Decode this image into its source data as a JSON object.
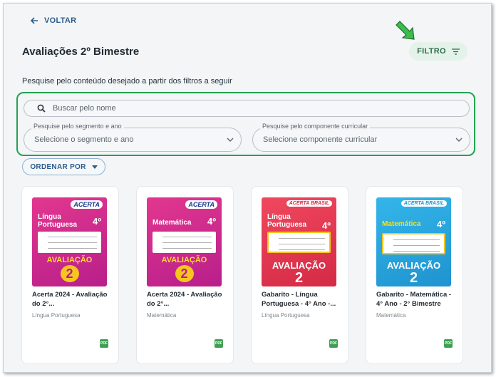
{
  "header": {
    "back_label": "VOLTAR",
    "title": "Avaliações 2º Bimestre",
    "filter_label": "FILTRO"
  },
  "filters": {
    "subtitle": "Pesquise pelo conteúdo desejado a partir dos filtros a seguir",
    "search_placeholder": "Buscar pelo nome",
    "segment_label": "Pesquise pelo segmento e ano",
    "segment_value": "Selecione o segmento e ano",
    "component_label": "Pesquise pelo componente curricular",
    "component_value": "Selecione componente curricular"
  },
  "sort": {
    "label": "ORDENAR POR"
  },
  "colors": {
    "accent_green": "#22a352",
    "link_blue": "#2c5c8c",
    "magenta_cover": "#d7288f",
    "red_cover": "#e23a52",
    "blue_cover": "#29a8e0"
  },
  "cards": [
    {
      "title": "Acerta 2024 - Avaliação do 2°...",
      "subject": "Língua Portuguesa",
      "badge": "PDF",
      "cover": {
        "brand": "ACERTA",
        "subject": "Língua Portuguesa",
        "grade": "4º",
        "label": "AVALIAÇÃO",
        "number": "2"
      }
    },
    {
      "title": "Acerta 2024 - Avaliação do 2°...",
      "subject": "Matemática",
      "badge": "PDF",
      "cover": {
        "brand": "ACERTA",
        "subject": "Matemática",
        "grade": "4º",
        "label": "AVALIAÇÃO",
        "number": "2"
      }
    },
    {
      "title": "Gabarito - Língua Portuguesa - 4° Ano -...",
      "subject": "Língua Portuguesa",
      "badge": "PDF",
      "cover": {
        "brand": "ACERTA BRASIL",
        "subject": "Língua Portuguesa",
        "grade": "4º",
        "label": "AVALIAÇÃO",
        "number": "2"
      }
    },
    {
      "title": "Gabarito - Matemática - 4° Ano - 2° Bimestre",
      "subject": "Matemática",
      "badge": "PDF",
      "cover": {
        "brand": "ACERTA BRASIL",
        "subject": "Matemática",
        "grade": "4º",
        "label": "AVALIAÇÃO",
        "number": "2"
      }
    }
  ]
}
